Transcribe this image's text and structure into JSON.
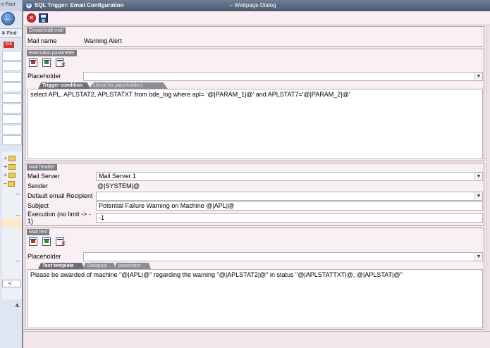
{
  "window": {
    "title": "SQL Trigger: Email Configuration",
    "subtitle": "-- Webpage Dialog"
  },
  "background_app": {
    "tab_label": "Fact",
    "find_label": "Find",
    "logo": "IGE",
    "scroll_left": "<",
    "page_number": "4."
  },
  "toolbar": {
    "cancel_icon": "cancel-icon",
    "save_icon": "save-icon"
  },
  "create_edit": {
    "header": "Create/edit mail",
    "mail_name_label": "Mail name",
    "mail_name_value": "Warning Alert"
  },
  "execution": {
    "header": "Execution parameter",
    "placeholder_label": "Placeholder",
    "placeholder_value": "",
    "tabs": [
      {
        "label": "Trigger condition",
        "active": true
      },
      {
        "label": "Literal for placeholders",
        "active": false
      }
    ],
    "sql": "select APL, APLSTAT2, APLSTATXT from bde_log where apl= '@|PARAM_1|@' and APLSTAT7='@|PARAM_2|@'"
  },
  "mail_header": {
    "header": "Mail header",
    "mail_server_label": "Mail Server",
    "mail_server_value": "Mail Server 1",
    "sender_label": "Sender",
    "sender_value": "@|SYSTEM|@",
    "default_recipient_label": "Default email Recipient",
    "default_recipient_value": "",
    "subject_label": "Subject",
    "subject_value": "Potential Failure Warning on Machine @|APL|@",
    "execution_label_1": "Execution (no limit -> -",
    "execution_label_2": "1)",
    "execution_value": "-1"
  },
  "mail_text": {
    "header": "Mail text",
    "placeholder_label": "Placeholder",
    "placeholder_value": "",
    "tabs": [
      {
        "label": "Text template",
        "active": true
      },
      {
        "label": "Datapool",
        "active": false
      },
      {
        "label": "parameter",
        "active": false
      }
    ],
    "body": "Please be awarded of machine \"@|APL|@\" regarding the warning \"@|APLSTAT2|@\" in status \"@|APLSTATTXT|@, @|APLSTAT|@\""
  },
  "colors": {
    "dialog_bg": "#f7edf2",
    "title_bar": "#4a566a",
    "section_header": "#7d7d84"
  }
}
